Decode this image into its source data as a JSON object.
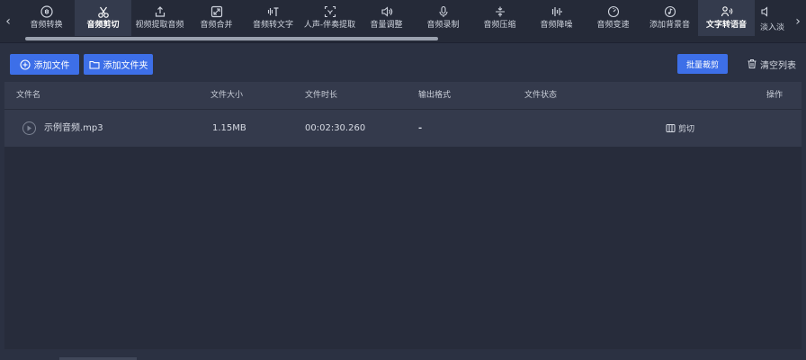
{
  "toolbar": {
    "tools": [
      {
        "label": "音频转换",
        "icon": "waveform-circle-icon"
      },
      {
        "label": "音频剪切",
        "icon": "scissors-icon",
        "active": true
      },
      {
        "label": "视频提取音频",
        "icon": "upload-icon"
      },
      {
        "label": "音频合并",
        "icon": "merge-icon"
      },
      {
        "label": "音频转文字",
        "icon": "text-wave-icon"
      },
      {
        "label": "人声-伴奏提取",
        "icon": "scan-face-icon"
      },
      {
        "label": "音量调整",
        "icon": "speaker-icon"
      },
      {
        "label": "音频录制",
        "icon": "microphone-icon"
      },
      {
        "label": "音频压缩",
        "icon": "compress-icon"
      },
      {
        "label": "音频降噪",
        "icon": "equalizer-icon"
      },
      {
        "label": "音频变速",
        "icon": "speedometer-icon"
      },
      {
        "label": "添加背景音",
        "icon": "music-disc-icon"
      },
      {
        "label": "文字转语音",
        "icon": "text-to-speech-icon"
      },
      {
        "label": "淡入淡",
        "icon": "fade-icon"
      }
    ],
    "prev_arrow": "‹",
    "next_arrow": "›"
  },
  "actions": {
    "add_file": "添加文件",
    "add_folder": "添加文件夹",
    "batch_cut": "批量裁剪",
    "clear_list": "清空列表"
  },
  "table": {
    "headers": [
      "文件名",
      "文件大小",
      "文件时长",
      "输出格式",
      "文件状态",
      "操作"
    ],
    "rows": [
      {
        "name": "示例音频.mp3",
        "size": "1.15MB",
        "duration": "00:02:30.260",
        "format": "-",
        "status": "",
        "action": "剪切"
      }
    ]
  },
  "colors": {
    "accent": "#3d6fe8",
    "background": "#2b3142",
    "toolbar": "#252a38",
    "header": "#343a4c"
  }
}
